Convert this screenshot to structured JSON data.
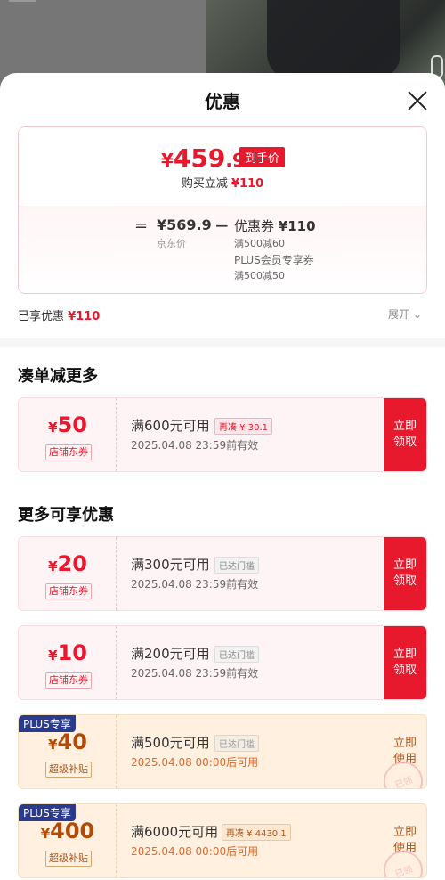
{
  "sheet": {
    "title": "优惠"
  },
  "summary": {
    "currency": "¥",
    "final_int": "459",
    "final_dec": ".9",
    "hand_price_badge": "到手价",
    "buy_save_label": "购买立减",
    "buy_save_amount": "¥110",
    "equals": "=",
    "jd_price": "¥569.9",
    "jd_price_label": "京东价",
    "minus": "−",
    "coupon_label": "优惠券",
    "coupon_amount": "¥110",
    "coupon_rule": "满500减60",
    "plus_label": "PLUS会员专享券",
    "plus_rule": "满500减50"
  },
  "enjoyed": {
    "label": "已享优惠",
    "amount": "¥110",
    "expand": "展开"
  },
  "sections": {
    "more_discount": "凑单减更多",
    "more_available": "更多可享优惠"
  },
  "coupons": [
    {
      "currency": "¥",
      "amount": "50",
      "tag": "店铺东券",
      "condition": "满600元可用",
      "pill": "再凑 ¥ 30.1",
      "valid": "2025.04.08  23:59前有效",
      "action": "立即领取"
    },
    {
      "currency": "¥",
      "amount": "20",
      "tag": "店铺东券",
      "condition": "满300元可用",
      "pill": "已达门槛",
      "valid": "2025.04.08  23:59前有效",
      "action": "立即领取"
    },
    {
      "currency": "¥",
      "amount": "10",
      "tag": "店铺东券",
      "condition": "满200元可用",
      "pill": "已达门槛",
      "valid": "2025.04.08  23:59前有效",
      "action": "立即领取"
    },
    {
      "badge": "PLUS专享",
      "currency": "¥",
      "amount": "40",
      "tag": "超级补贴",
      "condition": "满500元可用",
      "pill": "已达门槛",
      "valid": "2025.04.08  00:00后可用",
      "action": "立即使用",
      "stamp": "已领"
    },
    {
      "badge": "PLUS专享",
      "currency": "¥",
      "amount": "400",
      "tag": "超级补贴",
      "condition": "满6000元可用",
      "pill": "再凑 ¥ 4430.1",
      "valid": "2025.04.08  00:00后可用",
      "action": "立即使用",
      "stamp": "已领"
    }
  ],
  "colors": {
    "accent": "#e8192c",
    "plus_badge": "#2a3a8c",
    "gold_text": "#b24b08"
  }
}
